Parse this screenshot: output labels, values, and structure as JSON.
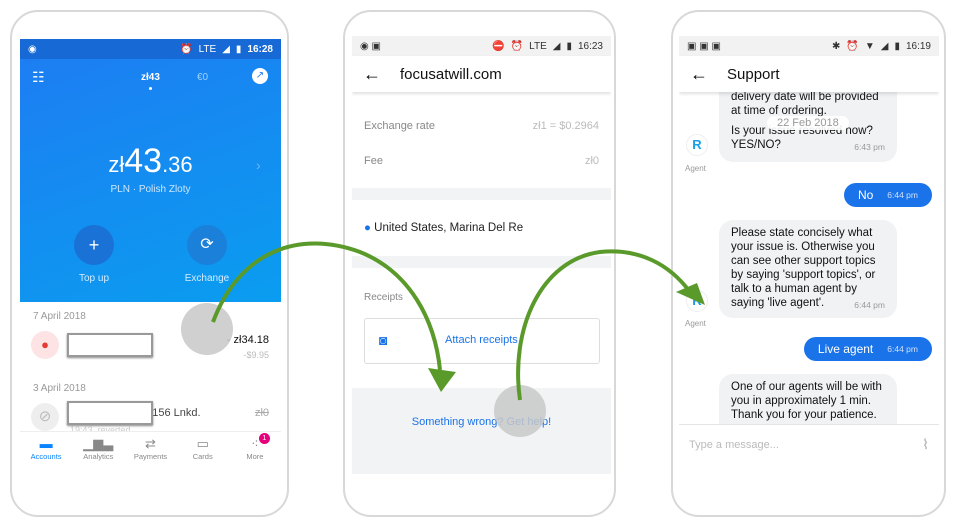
{
  "phone1": {
    "status": {
      "time": "16:28",
      "network": "LTE"
    },
    "tabs": [
      "zł43",
      "€0"
    ],
    "balance": {
      "currency": "zł",
      "whole": "43",
      "cents": ".36",
      "label": "PLN · Polish Zloty"
    },
    "actions": [
      {
        "label": "Top up",
        "icon": "plus-icon"
      },
      {
        "label": "Exchange",
        "icon": "exchange-icon"
      }
    ],
    "groups": [
      {
        "date": "7 April 2018",
        "amount": "- zł34.18",
        "sub": "-$9.95"
      },
      {
        "date": "3 April 2018",
        "name_tail": "39156 Lnkd.",
        "sub": "19:43, reverted",
        "amount": "zł0"
      }
    ],
    "nav": [
      {
        "label": "Accounts"
      },
      {
        "label": "Analytics"
      },
      {
        "label": "Payments"
      },
      {
        "label": "Cards"
      },
      {
        "label": "More",
        "badge": "1"
      }
    ],
    "accent": "#0a84ff"
  },
  "phone2": {
    "status": {
      "time": "16:23",
      "network": "LTE"
    },
    "title": "focusatwill.com",
    "rows": [
      {
        "label": "Exchange rate",
        "value": "zł1 = $0.2964"
      },
      {
        "label": "Fee",
        "value": "zł0"
      }
    ],
    "location": "United States, Marina Del Re",
    "receipts_label": "Receipts",
    "attach_label": "Attach receipts",
    "help_label": "Something wrong? Get help!"
  },
  "phone3": {
    "status": {
      "time": "16:19"
    },
    "title": "Support",
    "date_chip": "22 Feb 2018",
    "agent_label": "Agent",
    "messages": [
      {
        "from": "agent",
        "text_top": "delivery date will be provided",
        "text_mid": "at time of ordering.",
        "text": "Is your issue resolved now? YES/NO?",
        "time": "6:43 pm"
      },
      {
        "from": "me",
        "text": "No",
        "time": "6:44 pm"
      },
      {
        "from": "agent",
        "text": "Please state concisely what your issue is. Otherwise you can see other support topics by saying 'support topics', or talk to a human agent by saying 'live agent'.",
        "time": "6:44 pm"
      },
      {
        "from": "me",
        "text": "Live agent",
        "time": "6:44 pm"
      },
      {
        "from": "agent",
        "text": "One of our agents will be with you in approximately 1 min. Thank you for your patience."
      }
    ],
    "input_placeholder": "Type a message..."
  },
  "arrow_color": "#5a9a2a"
}
